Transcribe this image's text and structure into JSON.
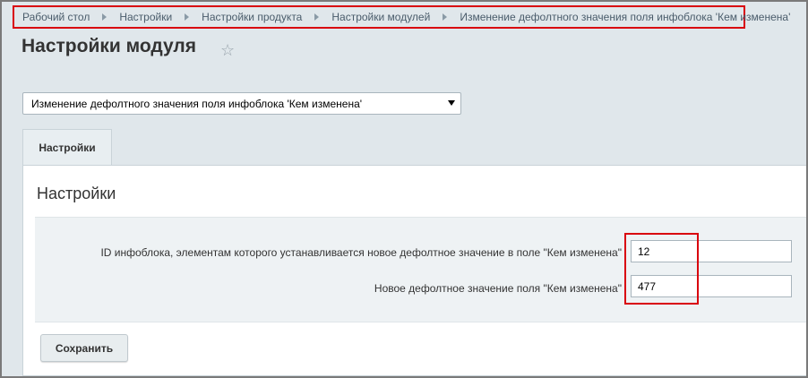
{
  "breadcrumb": {
    "items": [
      "Рабочий стол",
      "Настройки",
      "Настройки продукта",
      "Настройки модулей",
      "Изменение дефолтного значения поля инфоблока 'Кем изменена'"
    ]
  },
  "page": {
    "title": "Настройки модуля"
  },
  "module_select": {
    "selected": "Изменение дефолтного значения поля инфоблока 'Кем изменена'"
  },
  "tabs": [
    {
      "label": "Настройки"
    }
  ],
  "panel": {
    "title": "Настройки",
    "fields": [
      {
        "label": "ID инфоблока, элементам которого устанавливается новое дефолтное значение в поле \"Кем изменена\"",
        "value": "12"
      },
      {
        "label": "Новое дефолтное значение поля \"Кем изменена\"",
        "value": "477"
      }
    ],
    "save_label": "Сохранить"
  },
  "colors": {
    "highlight": "#d9000d",
    "background": "#e0e7eb"
  }
}
